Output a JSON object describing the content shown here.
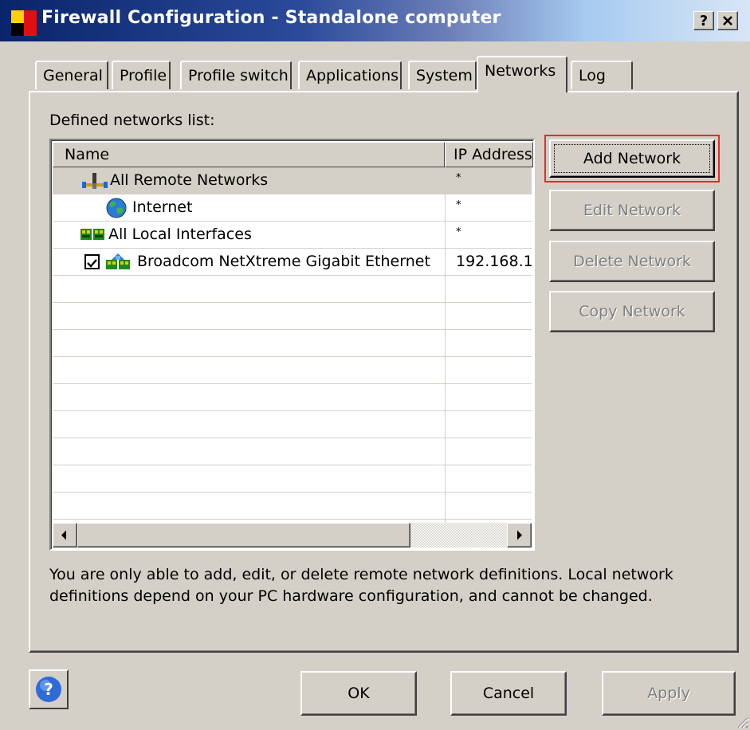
{
  "window": {
    "title": "Firewall Configuration - Standalone computer",
    "help_caption": "?",
    "close_caption": "✕"
  },
  "tabs": [
    {
      "label": "General"
    },
    {
      "label": "Profile"
    },
    {
      "label": "Profile switch"
    },
    {
      "label": "Applications"
    },
    {
      "label": "System"
    },
    {
      "label": "Networks",
      "active": true
    },
    {
      "label": "Log"
    }
  ],
  "networks": {
    "list_label": "Defined networks list:",
    "columns": {
      "name": "Name",
      "ip": "IP Address"
    },
    "rows": [
      {
        "name": "All Remote Networks",
        "ip": "*",
        "icon": "remote-networks-icon"
      },
      {
        "name": "Internet",
        "ip": "*",
        "icon": "internet-globe-icon"
      },
      {
        "name": "All Local Interfaces",
        "ip": "*",
        "icon": "local-interfaces-icon"
      },
      {
        "name": "Broadcom NetXtreme Gigabit Ethernet",
        "ip": "192.168.1",
        "icon": "network-adapter-icon",
        "checked": true
      }
    ],
    "buttons": {
      "add": "Add Network",
      "edit": "Edit Network",
      "delete": "Delete Network",
      "copy": "Copy Network"
    },
    "info_line1": "You are only able to add, edit, or delete remote network definitions. Local network",
    "info_line2": "definitions depend on your PC hardware configuration, and cannot be changed."
  },
  "footer": {
    "ok": "OK",
    "cancel": "Cancel",
    "apply": "Apply"
  },
  "colors": {
    "titlebar_start": "#0a246a",
    "highlight_box": "#e8282a",
    "face": "#d4d0c8"
  }
}
